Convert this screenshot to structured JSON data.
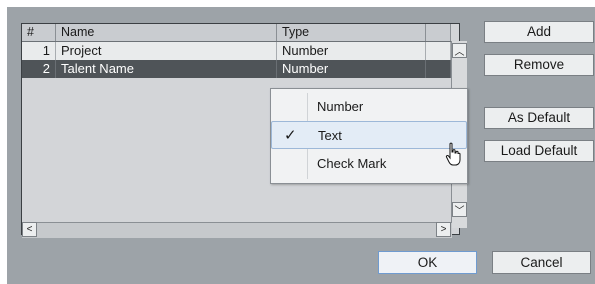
{
  "table": {
    "columns": [
      "#",
      "Name",
      "Type"
    ],
    "rows": [
      {
        "index": "1",
        "name": "Project",
        "type": "Number"
      },
      {
        "index": "2",
        "name": "Talent Name",
        "type": "Number"
      }
    ]
  },
  "type_menu": {
    "options": [
      {
        "label": "Number",
        "checked": false
      },
      {
        "label": "Text",
        "checked": true
      },
      {
        "label": "Check Mark",
        "checked": false
      }
    ],
    "check_glyph": "✓"
  },
  "buttons": {
    "add": "Add",
    "remove": "Remove",
    "as_default": "As Default",
    "load_default": "Load Default",
    "ok": "OK",
    "cancel": "Cancel"
  },
  "scroll_glyphs": {
    "up": "︿",
    "down": "﹀",
    "left": "<",
    "right": ">"
  },
  "colors": {
    "selected_row": "#4f5458",
    "dialog_bg": "#9da3a8",
    "menu_highlight": "#e3ecf6"
  }
}
